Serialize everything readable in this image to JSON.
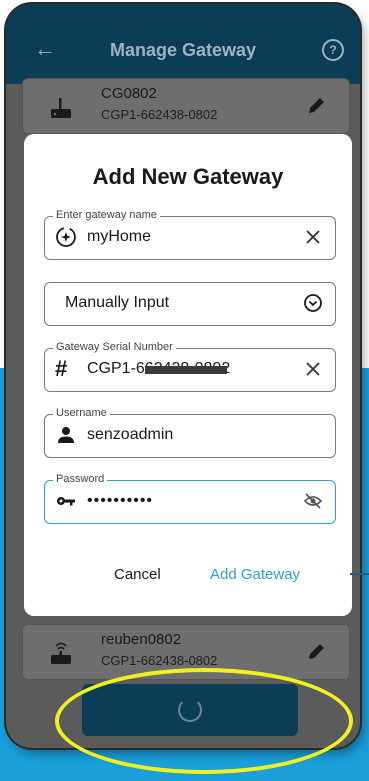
{
  "appbar": {
    "title": "Manage Gateway"
  },
  "gateways": [
    {
      "name": "CG0802",
      "serial": "CGP1-662438-0802"
    },
    {
      "name": "reuben0802",
      "serial": "CGP1-662438-0802"
    }
  ],
  "dialog": {
    "title": "Add New Gateway",
    "name_field": {
      "label": "Enter gateway name",
      "value": "myHome"
    },
    "mode_select": {
      "value": "Manually Input"
    },
    "serial_field": {
      "label": "Gateway Serial Number",
      "value": "CGP1-662438-0802"
    },
    "username_field": {
      "label": "Username",
      "value": "senzoadmin"
    },
    "password_field": {
      "label": "Password",
      "value": "••••••••••"
    },
    "cancel_label": "Cancel",
    "add_label": "Add Gateway"
  },
  "colors": {
    "appbar": "#0c3d56",
    "accent": "#2f9fd0",
    "highlight": "#f1f121",
    "background_panel": "#1a9fd9"
  },
  "icons": {
    "back": "arrow-left-icon",
    "help": "help-circle-icon",
    "router": "router-icon",
    "edit": "pencil-icon",
    "name": "sparkle-circle-icon",
    "dropdown": "chevron-down-circle-icon",
    "serial": "hash-icon",
    "user": "person-icon",
    "password": "key-icon",
    "visibility": "eye-off-icon",
    "clear": "close-icon",
    "loading": "spinner-icon"
  }
}
